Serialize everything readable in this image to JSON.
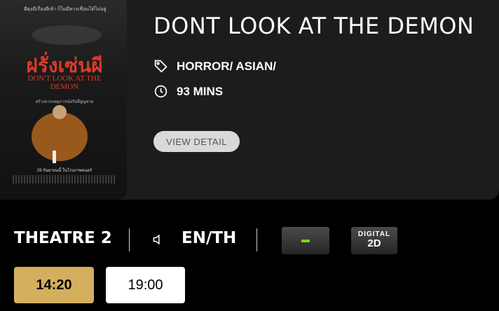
{
  "movie": {
    "title": "DONT LOOK AT THE DEMON",
    "genre": "HORROR/ ASIAN/",
    "duration": "93 MINS",
    "view_detail_label": "VIEW DETAIL",
    "poster": {
      "tagline": "ผีดุงมีเรื่องผีเข้า ก็ไม่มีทางเชื่อนได้ไม่อยู่",
      "title_thai": "ฝรั่งเซ่นผี",
      "title_en": "DON'T LOOK AT THE DEMON",
      "subtitle": "สร้างจากเหตุการณ์จริงที่สูญหาย",
      "release": "29 กันยายนนี้ ในโรงภาพยนตร์"
    }
  },
  "session": {
    "theatre": "THEATRE 2",
    "language": "EN/TH",
    "format_top": "DIGITAL",
    "format_bottom": "2D",
    "rating_color": "#7ed321",
    "accent_color": "#d4af5e"
  },
  "showtimes": [
    {
      "time": "14:20",
      "selected": true
    },
    {
      "time": "19:00",
      "selected": false
    }
  ]
}
